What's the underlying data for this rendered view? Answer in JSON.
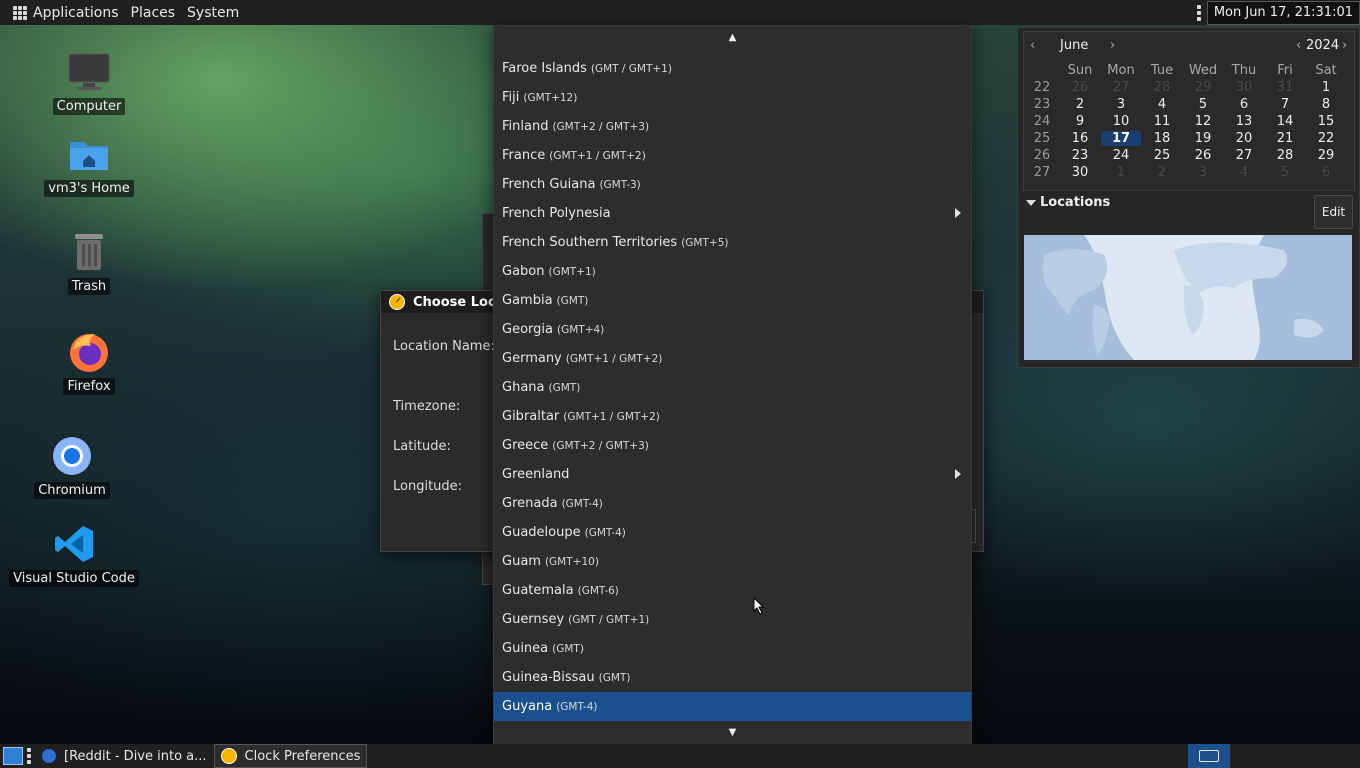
{
  "top_panel": {
    "menus": [
      "Applications",
      "Places",
      "System"
    ],
    "clock": "Mon Jun 17, 21:31:01"
  },
  "desktop_icons": [
    {
      "label": "Computer",
      "icon": "computer-icon"
    },
    {
      "label": "vm3's Home",
      "icon": "home-folder-icon"
    },
    {
      "label": "Trash",
      "icon": "trash-icon"
    },
    {
      "label": "Firefox",
      "icon": "firefox-icon"
    },
    {
      "label": "Chromium",
      "icon": "chromium-icon"
    },
    {
      "label": "Visual Studio Code",
      "icon": "vscode-icon"
    }
  ],
  "dialog": {
    "title": "Choose Locat",
    "labels": {
      "location_name": "Location Name:",
      "timezone": "Timezone:",
      "latitude": "Latitude:",
      "longitude": "Longitude:"
    }
  },
  "dropdown": {
    "items": [
      {
        "name": "Faroe Islands",
        "tz": "(GMT / GMT+1)",
        "submenu": false,
        "selected": false
      },
      {
        "name": "Fiji",
        "tz": "(GMT+12)",
        "submenu": false,
        "selected": false
      },
      {
        "name": "Finland",
        "tz": "(GMT+2 / GMT+3)",
        "submenu": false,
        "selected": false
      },
      {
        "name": "France",
        "tz": "(GMT+1 / GMT+2)",
        "submenu": false,
        "selected": false
      },
      {
        "name": "French Guiana",
        "tz": "(GMT-3)",
        "submenu": false,
        "selected": false
      },
      {
        "name": "French Polynesia",
        "tz": "",
        "submenu": true,
        "selected": false
      },
      {
        "name": "French Southern Territories",
        "tz": "(GMT+5)",
        "submenu": false,
        "selected": false
      },
      {
        "name": "Gabon",
        "tz": "(GMT+1)",
        "submenu": false,
        "selected": false
      },
      {
        "name": "Gambia",
        "tz": "(GMT)",
        "submenu": false,
        "selected": false
      },
      {
        "name": "Georgia",
        "tz": "(GMT+4)",
        "submenu": false,
        "selected": false
      },
      {
        "name": "Germany",
        "tz": "(GMT+1 / GMT+2)",
        "submenu": false,
        "selected": false
      },
      {
        "name": "Ghana",
        "tz": "(GMT)",
        "submenu": false,
        "selected": false
      },
      {
        "name": "Gibraltar",
        "tz": "(GMT+1 / GMT+2)",
        "submenu": false,
        "selected": false
      },
      {
        "name": "Greece",
        "tz": "(GMT+2 / GMT+3)",
        "submenu": false,
        "selected": false
      },
      {
        "name": "Greenland",
        "tz": "",
        "submenu": true,
        "selected": false
      },
      {
        "name": "Grenada",
        "tz": "(GMT-4)",
        "submenu": false,
        "selected": false
      },
      {
        "name": "Guadeloupe",
        "tz": "(GMT-4)",
        "submenu": false,
        "selected": false
      },
      {
        "name": "Guam",
        "tz": "(GMT+10)",
        "submenu": false,
        "selected": false
      },
      {
        "name": "Guatemala",
        "tz": "(GMT-6)",
        "submenu": false,
        "selected": false
      },
      {
        "name": "Guernsey",
        "tz": "(GMT / GMT+1)",
        "submenu": false,
        "selected": false
      },
      {
        "name": "Guinea",
        "tz": "(GMT)",
        "submenu": false,
        "selected": false
      },
      {
        "name": "Guinea-Bissau",
        "tz": "(GMT)",
        "submenu": false,
        "selected": false
      },
      {
        "name": "Guyana",
        "tz": "(GMT-4)",
        "submenu": false,
        "selected": true
      }
    ]
  },
  "calendar": {
    "month": "June",
    "year": "2024",
    "weekday_headers": [
      "Sun",
      "Mon",
      "Tue",
      "Wed",
      "Thu",
      "Fri",
      "Sat"
    ],
    "weeks": [
      {
        "week": "22",
        "days": [
          [
            "26",
            true
          ],
          [
            "27",
            true
          ],
          [
            "28",
            true
          ],
          [
            "29",
            true
          ],
          [
            "30",
            true
          ],
          [
            "31",
            true
          ],
          [
            "1",
            false
          ]
        ]
      },
      {
        "week": "23",
        "days": [
          [
            "2",
            false
          ],
          [
            "3",
            false
          ],
          [
            "4",
            false
          ],
          [
            "5",
            false
          ],
          [
            "6",
            false
          ],
          [
            "7",
            false
          ],
          [
            "8",
            false
          ]
        ]
      },
      {
        "week": "24",
        "days": [
          [
            "9",
            false
          ],
          [
            "10",
            false
          ],
          [
            "11",
            false
          ],
          [
            "12",
            false
          ],
          [
            "13",
            false
          ],
          [
            "14",
            false
          ],
          [
            "15",
            false
          ]
        ]
      },
      {
        "week": "25",
        "days": [
          [
            "16",
            false
          ],
          [
            "17",
            false
          ],
          [
            "18",
            false
          ],
          [
            "19",
            false
          ],
          [
            "20",
            false
          ],
          [
            "21",
            false
          ],
          [
            "22",
            false
          ]
        ]
      },
      {
        "week": "26",
        "days": [
          [
            "23",
            false
          ],
          [
            "24",
            false
          ],
          [
            "25",
            false
          ],
          [
            "26",
            false
          ],
          [
            "27",
            false
          ],
          [
            "28",
            false
          ],
          [
            "29",
            false
          ]
        ]
      },
      {
        "week": "27",
        "days": [
          [
            "30",
            false
          ],
          [
            "1",
            true
          ],
          [
            "2",
            true
          ],
          [
            "3",
            true
          ],
          [
            "4",
            true
          ],
          [
            "5",
            true
          ],
          [
            "6",
            true
          ]
        ]
      }
    ],
    "today": "17",
    "locations_title": "Locations",
    "edit_label": "Edit"
  },
  "bottom_panel": {
    "tasks": [
      {
        "label": "[Reddit - Dive into a...",
        "icon": "browser-icon",
        "active": false
      },
      {
        "label": "Clock Preferences",
        "icon": "clock-icon",
        "active": true
      }
    ]
  }
}
